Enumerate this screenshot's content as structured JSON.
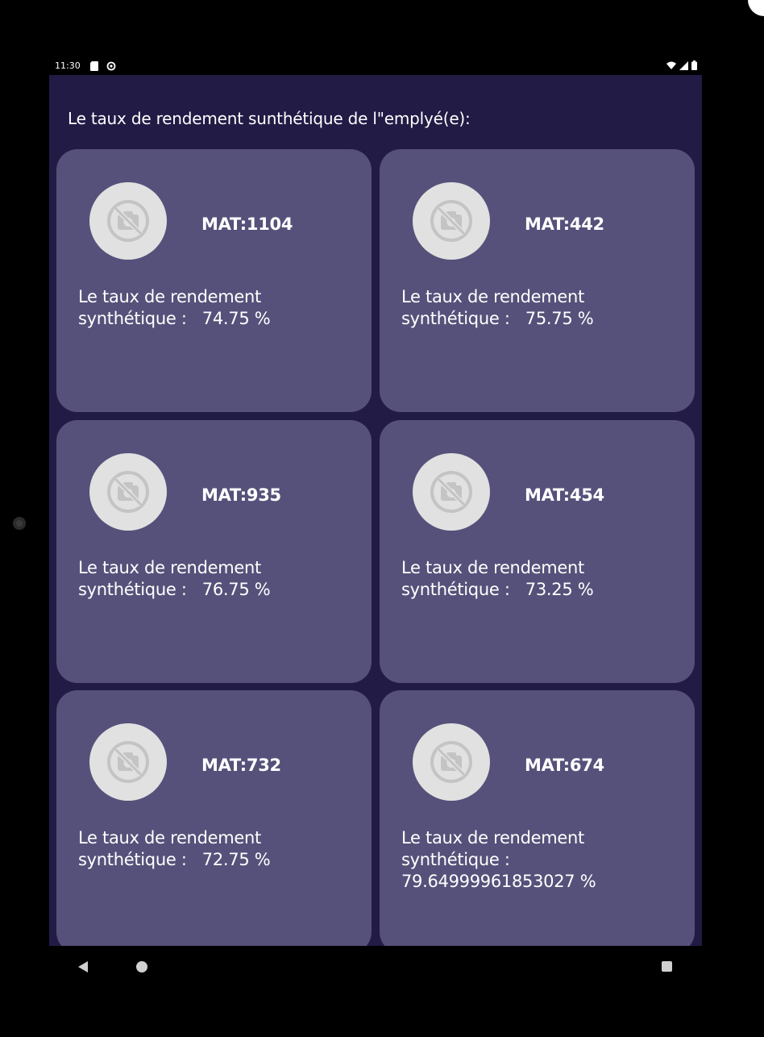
{
  "status_bar": {
    "time": "11:30",
    "icons": [
      "sd-card-icon",
      "sync-icon",
      "wifi-icon",
      "signal-icon",
      "battery-icon"
    ]
  },
  "page": {
    "title": "Le taux de rendement sunthétique de l\"emplyé(e):"
  },
  "colors": {
    "background": "#211b45",
    "card": "#56517a",
    "avatar": "#e1e1e1",
    "text": "#ffffff"
  },
  "employees": [
    {
      "mat": "MAT:1104",
      "rate_label": "Le taux de rendement synthétique :",
      "rate_value": "74.75 %"
    },
    {
      "mat": "MAT:442",
      "rate_label": "Le taux de rendement synthétique :",
      "rate_value": "75.75 %"
    },
    {
      "mat": "MAT:935",
      "rate_label": "Le taux de rendement synthétique :",
      "rate_value": "76.75 %"
    },
    {
      "mat": "MAT:454",
      "rate_label": "Le taux de rendement synthétique :",
      "rate_value": "73.25 %"
    },
    {
      "mat": "MAT:732",
      "rate_label": "Le taux de rendement synthétique :",
      "rate_value": "72.75 %"
    },
    {
      "mat": "MAT:674",
      "rate_label": "Le taux de rendement synthétique :",
      "rate_value": "79.64999961853027 %"
    }
  ],
  "nav_bar": {
    "buttons": [
      "back-icon",
      "home-icon",
      "recents-icon"
    ]
  }
}
